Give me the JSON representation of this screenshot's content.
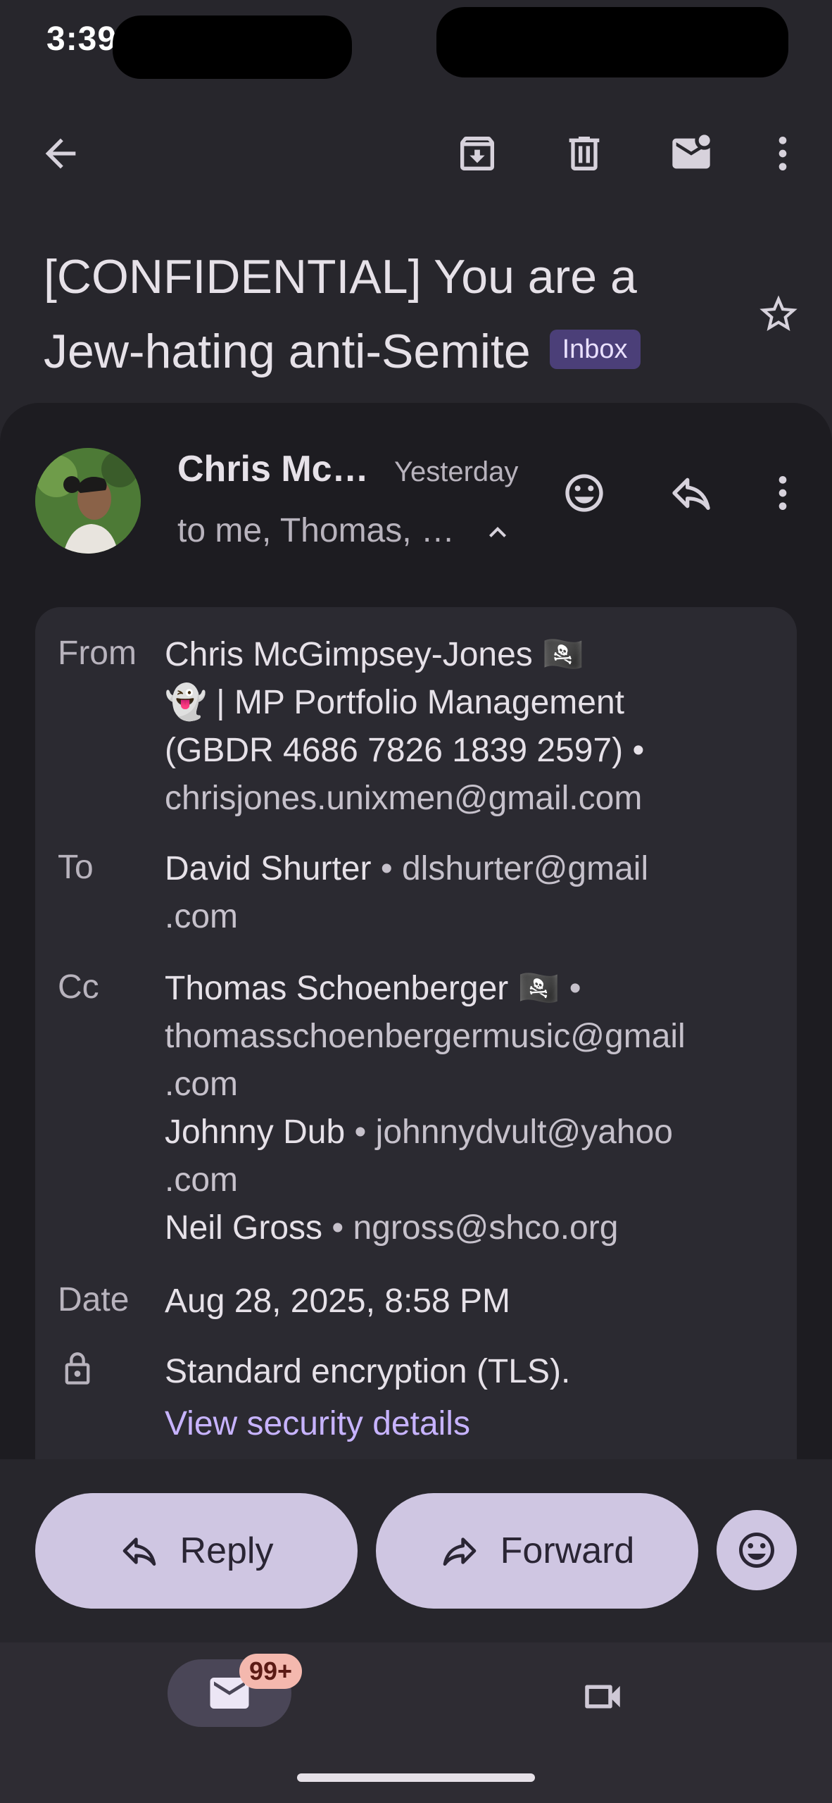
{
  "status_bar": {
    "time": "3:39"
  },
  "toolbar": {
    "back_icon": "arrow-back-icon",
    "archive_icon": "archive-icon",
    "delete_icon": "trash-icon",
    "mark_unread_icon": "mail-unread-icon",
    "more_icon": "more-vert-icon"
  },
  "subject": {
    "text": "[CONFIDENTIAL] You are a Jew-hating anti-Semite",
    "label_chip": "Inbox"
  },
  "message": {
    "sender_short": "Chris Mc…",
    "time": "Yesterday",
    "recipients_summary": "to me, Thomas, …",
    "details": {
      "from_label": "From",
      "from_name": "Chris McGimpsey-Jones 🏴‍☠️",
      "from_name_line2": "👻 | MP Portfolio Management",
      "from_name_line3": "(GBDR 4686 7826 1839 2597) •",
      "from_email": "chrisjones.unixmen@gmail.com",
      "to_label": "To",
      "to_name": "David Shurter",
      "to_email_line1": "• dlshurter@gmail",
      "to_email_line2": ".com",
      "cc_label": "Cc",
      "cc": [
        {
          "name": "Thomas Schoenberger 🏴‍☠️",
          "sep": " •",
          "email_line1": "thomasschoenbergermusic@gmail",
          "email_line2": ".com"
        },
        {
          "name": "Johnny Dub",
          "sep": " • ",
          "email_line1": "johnnydvult@yahoo",
          "email_line2": ".com"
        },
        {
          "name": "Neil Gross",
          "sep": " • ",
          "email_line1": "ngross@shco.org",
          "email_line2": ""
        }
      ],
      "date_label": "Date",
      "date_value": "Aug 28, 2025, 8:58 PM",
      "encryption_text": "Standard encryption (TLS).",
      "security_link": "View security details"
    }
  },
  "actions": {
    "reply": "Reply",
    "forward": "Forward"
  },
  "bottom_nav": {
    "mail_badge": "99+"
  }
}
